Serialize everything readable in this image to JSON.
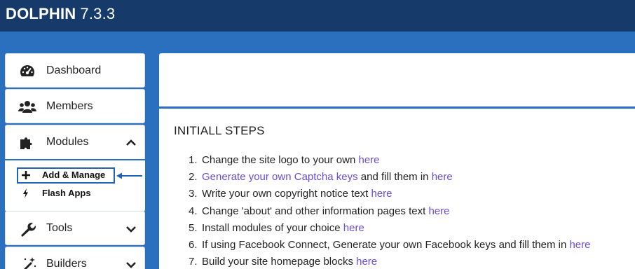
{
  "header": {
    "brand": "DOLPHIN",
    "version": "7.3.3"
  },
  "sidebar": {
    "items": [
      {
        "label": "Dashboard",
        "icon": "dashboard-icon"
      },
      {
        "label": "Members",
        "icon": "members-icon"
      },
      {
        "label": "Modules",
        "icon": "puzzle-icon",
        "expanded": true
      },
      {
        "label": "Tools",
        "icon": "wrench-icon"
      },
      {
        "label": "Builders",
        "icon": "magic-wand-icon"
      }
    ],
    "modules_sub": [
      {
        "label": "Add & Manage",
        "icon": "plus-icon",
        "active": true
      },
      {
        "label": "Flash Apps",
        "icon": "bolt-icon"
      }
    ]
  },
  "main": {
    "heading": "INITIALL STEPS",
    "steps": [
      {
        "num": "1.",
        "pre": "Change the site logo to your own ",
        "link1": "",
        "mid": "",
        "link2": "here"
      },
      {
        "num": "2.",
        "pre": "",
        "link1": "Generate your own Captcha keys",
        "mid": " and fill them in ",
        "link2": "here"
      },
      {
        "num": "3.",
        "pre": "Write your own copyright notice text ",
        "link1": "",
        "mid": "",
        "link2": "here"
      },
      {
        "num": "4.",
        "pre": "Change 'about' and other information pages text ",
        "link1": "",
        "mid": "",
        "link2": "here"
      },
      {
        "num": "5.",
        "pre": "Install modules of your choice ",
        "link1": "",
        "mid": "",
        "link2": "here"
      },
      {
        "num": "6.",
        "pre": "If using Facebook Connect, Generate your own Facebook keys and fill them in ",
        "link1": "",
        "mid": "",
        "link2": "here"
      },
      {
        "num": "7.",
        "pre": "Build your site homepage blocks ",
        "link1": "",
        "mid": "",
        "link2": "here"
      }
    ]
  },
  "colors": {
    "header_bg": "#163b6b",
    "page_bg": "#2b6fbf",
    "link": "#6a4dd6",
    "highlight": "#2161b7"
  }
}
